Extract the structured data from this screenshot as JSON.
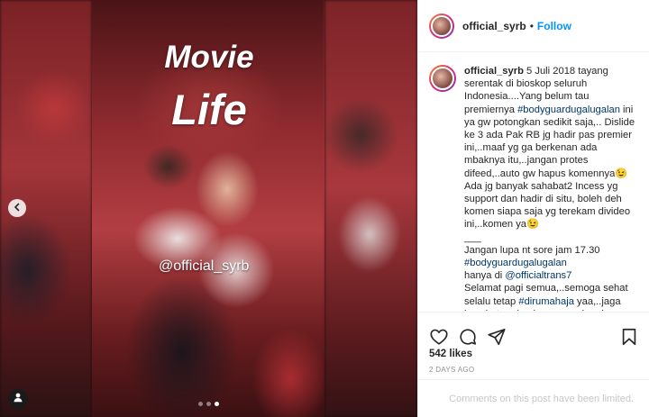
{
  "post": {
    "username": "official_syrb",
    "follow_label": "Follow",
    "separator": "•",
    "media": {
      "overlay_line1": "Movie",
      "overlay_line2": "Life",
      "watermark": "@official_syrb",
      "carousel_slides": 3,
      "active_slide": 3
    },
    "caption": {
      "username": "official_syrb",
      "segments": [
        {
          "text": " 5 Juli 2018 tayang serentak di bioskop seluruh Indonesia....Yang belum tau premiernya ",
          "tag": false
        },
        {
          "text": "#bodyguardugalugalan",
          "tag": true
        },
        {
          "text": " ini ya gw potongkan sedikit saja,.. Dislide ke 3 ada Pak RB jg hadir pas premier ini,..maaf yg ga berkenan ada mbaknya itu,..jangan protes difeed,..auto gw hapus komennya😉 Ada jg banyak sahabat2 Incess yg support dan hadir di situ, boleh deh komen siapa saja yg terekam divideo ini,..komen ya😉",
          "tag": false
        }
      ],
      "rule": "___",
      "line2_text": "Jangan lupa nt sore jam 17.30",
      "line2_tag": "#bodyguardugalugalan",
      "line3_prefix": "hanya di ",
      "line3_tag": "@officialtrans7",
      "line4_prefix": "Selamat pagi semua,..semoga sehat selalu tetap ",
      "line4_tag": "#dirumahaja",
      "line4_suffix": " yaa,..jaga kesehatan dan happy weekend"
    },
    "likes": "542 likes",
    "date": "2 DAYS AGO",
    "comments_limited": "Comments on this post have been limited."
  },
  "icons": {
    "like": "heart-icon",
    "comment": "comment-icon",
    "share": "share-icon",
    "save": "bookmark-icon",
    "prev": "chevron-left-icon",
    "tagged": "user-tag-icon"
  },
  "colors": {
    "accent": "#0095f6",
    "hashtag": "#00376b",
    "muted": "#8e8e8e",
    "limited": "#c7c7c7"
  }
}
